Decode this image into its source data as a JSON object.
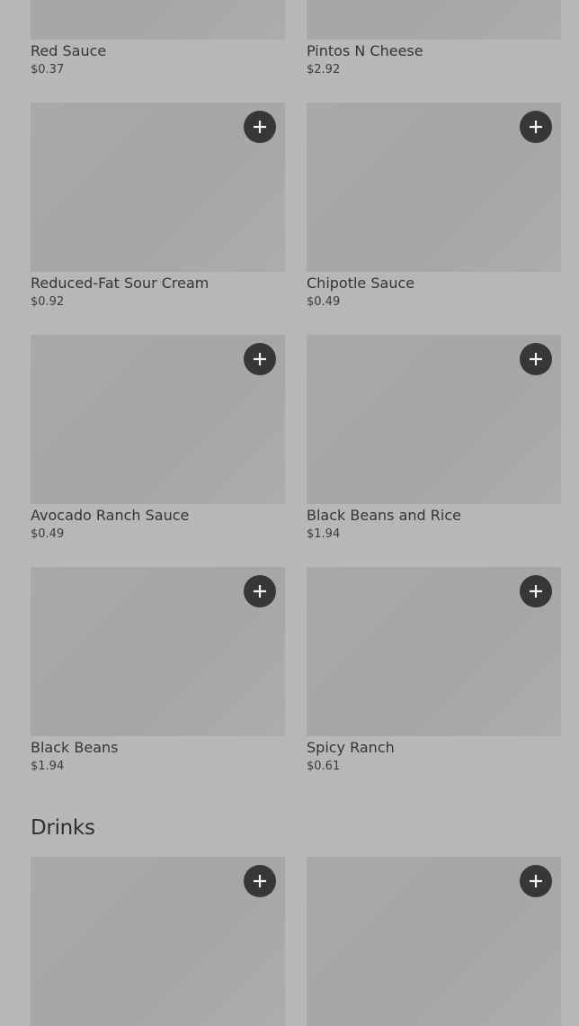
{
  "menu": {
    "items": [
      {
        "name": "Red Sauce",
        "price": "$0.37"
      },
      {
        "name": "Pintos N Cheese",
        "price": "$2.92"
      },
      {
        "name": "Reduced-Fat Sour Cream",
        "price": "$0.92"
      },
      {
        "name": "Chipotle Sauce",
        "price": "$0.49"
      },
      {
        "name": "Avocado Ranch Sauce",
        "price": "$0.49"
      },
      {
        "name": "Black Beans and Rice",
        "price": "$1.94"
      },
      {
        "name": "Black Beans",
        "price": "$1.94"
      },
      {
        "name": "Spicy Ranch",
        "price": "$0.61"
      }
    ]
  },
  "sections": {
    "drinks_title": "Drinks"
  },
  "icons": {
    "add": "plus-icon"
  },
  "colors": {
    "background": "#b7b7b7",
    "image_placeholder": "#a8a8a8",
    "add_button": "#373737",
    "text": "#353535"
  }
}
